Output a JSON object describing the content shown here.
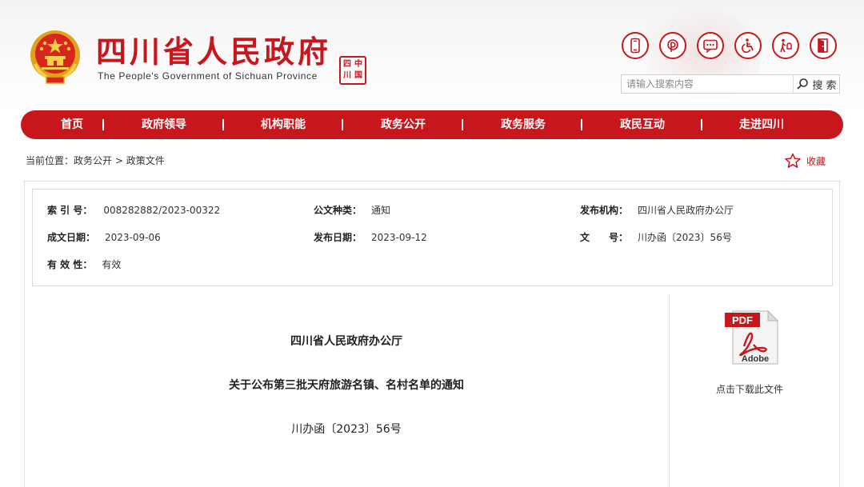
{
  "header": {
    "title_cn": "四川省人民政府",
    "title_en": "The People's Government of Sichuan Province",
    "seal_text": "中国四川",
    "brand_color": "#c8161d",
    "icons": [
      "mobile-icon",
      "weibo-icon",
      "message-icon",
      "accessibility-icon",
      "elderly-care-icon",
      "exit-icon"
    ]
  },
  "search": {
    "placeholder": "请输入搜索内容",
    "button_label": "搜 索"
  },
  "nav": {
    "items": [
      "首页",
      "政府领导",
      "机构职能",
      "政务公开",
      "政务服务",
      "政民互动",
      "走进四川"
    ],
    "separator": "|"
  },
  "breadcrumb": {
    "prefix": "当前位置：",
    "level1": "政务公开",
    "sep": " > ",
    "level2": "政策文件"
  },
  "favorite": {
    "label": "收藏"
  },
  "meta": {
    "index_label": "索 引 号：",
    "index_value": "008282882/2023-00322",
    "type_label": "公文种类：",
    "type_value": "通知",
    "issuer_label": "发布机构：",
    "issuer_value": "四川省人民政府办公厅",
    "created_label": "成文日期：",
    "created_value": "2023-09-06",
    "published_label": "发布日期：",
    "published_value": "2023-09-12",
    "docno_label": "文　　号：",
    "docno_value": "川办函〔2023〕56号",
    "validity_label": "有 效 性：",
    "validity_value": "有效"
  },
  "document": {
    "issuer": "四川省人民政府办公厅",
    "title": "关于公布第三批天府旅游名镇、名村名单的通知",
    "number": "川办函〔2023〕56号"
  },
  "download": {
    "badge": "PDF",
    "brand": "Adobe",
    "caption": "点击下载此文件"
  }
}
